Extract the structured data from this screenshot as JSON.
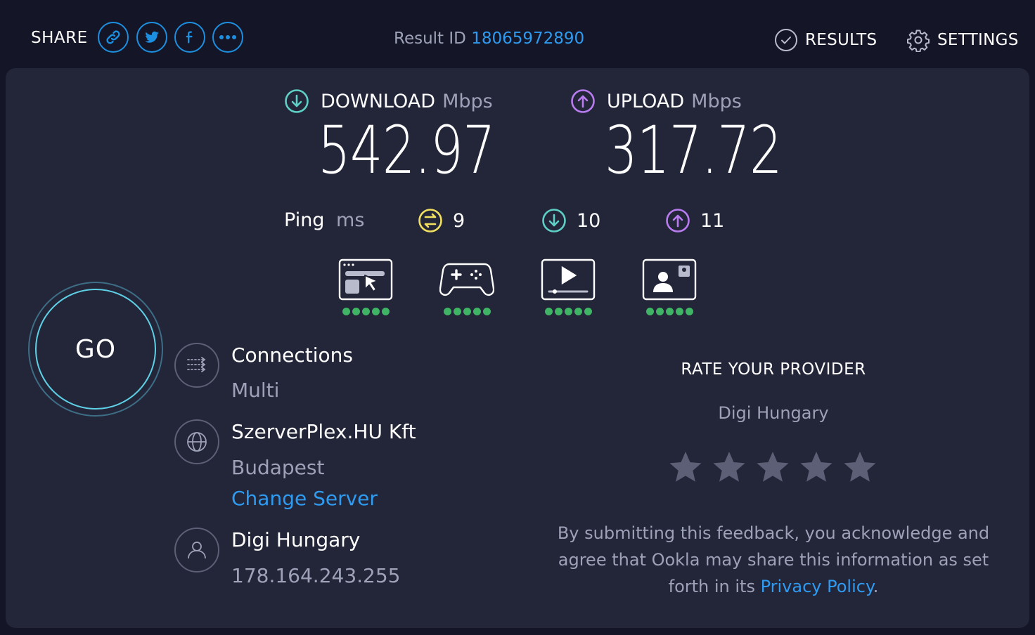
{
  "header": {
    "share_label": "SHARE",
    "share_buttons": [
      {
        "name": "link-icon"
      },
      {
        "name": "twitter-icon"
      },
      {
        "name": "facebook-icon"
      },
      {
        "name": "more-icon"
      }
    ],
    "result_id_label": "Result ID",
    "result_id_value": "18065972890",
    "results_label": "RESULTS",
    "settings_label": "SETTINGS"
  },
  "speeds": {
    "download_label": "DOWNLOAD",
    "download_unit": "Mbps",
    "download_value": "542.97",
    "upload_label": "UPLOAD",
    "upload_unit": "Mbps",
    "upload_value": "317.72"
  },
  "ping": {
    "label": "Ping",
    "unit": "ms",
    "idle": "9",
    "download": "10",
    "upload": "11"
  },
  "quality": [
    {
      "name": "web-browsing-icon",
      "rating": 5
    },
    {
      "name": "gaming-icon",
      "rating": 5
    },
    {
      "name": "video-streaming-icon",
      "rating": 5
    },
    {
      "name": "video-call-icon",
      "rating": 5
    }
  ],
  "go_label": "GO",
  "connections": {
    "title": "Connections",
    "value": "Multi"
  },
  "server": {
    "name": "SzerverPlex.HU Kft",
    "location": "Budapest",
    "change_label": "Change Server"
  },
  "isp": {
    "name": "Digi Hungary",
    "ip": "178.164.243.255"
  },
  "rating": {
    "title": "RATE YOUR PROVIDER",
    "provider": "Digi Hungary",
    "stars": 5,
    "disclaimer_text": "By submitting this feedback, you acknowledge and agree that Ookla may share this information as set forth in its ",
    "privacy_link": "Privacy Policy",
    "disclaimer_end": "."
  },
  "colors": {
    "background": "#141526",
    "card": "#232539",
    "accent_blue": "#2f9bf0",
    "download": "#5ed0c6",
    "upload": "#b97cf0",
    "ping_idle": "#f2e05f",
    "quality_green": "#3fb464"
  }
}
